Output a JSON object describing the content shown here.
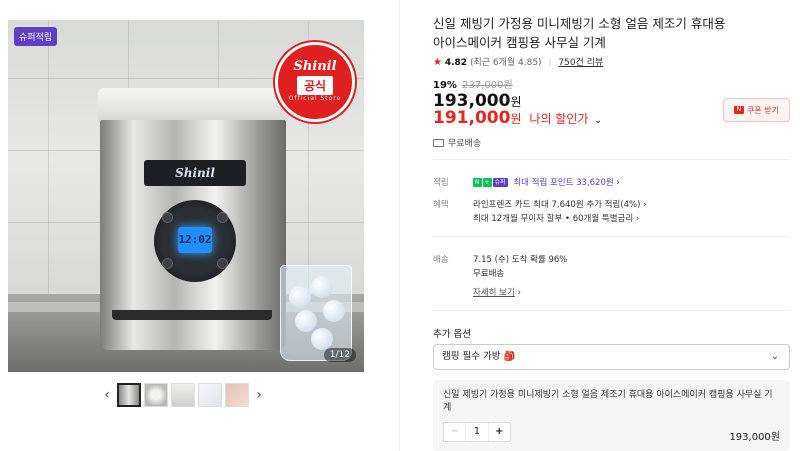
{
  "gallery": {
    "badge": "슈퍼적립",
    "seal": {
      "brand": "Shinil",
      "subtitle": "Official Store",
      "tag": "공식"
    },
    "machine_window_text": "Shinil",
    "lcd_text": "12:02",
    "image_counter": "1/12",
    "prev_icon": "chevron-left-icon",
    "next_icon": "chevron-right-icon"
  },
  "product": {
    "title": "신일 제빙기 가정용 미니제빙기 소형 얼음 제조기 휴대용 아이스메이커 캠핑용 사무실 기계",
    "rating": {
      "score": "4.82",
      "detail": "(최근 6개월 4.85)",
      "reviews": "750건 리뷰"
    },
    "discount_pct": "19%",
    "original_price": "237,000원",
    "price": "193,000",
    "price_unit": "원",
    "my_price": "191,000",
    "my_price_unit": "원",
    "my_price_label": "나의 할인가",
    "coupon_label": "쿠폰 받기",
    "free_shipping": "무료배송"
  },
  "details": {
    "points_label": "적립",
    "points_badges": [
      "N",
      "+",
      "슈퍼"
    ],
    "points_text": "최대 적립 포인트 33,620원",
    "benefit_label": "혜택",
    "benefit_line1": "라인프렌즈 카드 최대 7,640원 추가 적립(4%)",
    "benefit_line2": "최대 12개월 무이자 할부 • 60개월 특별금리",
    "delivery_label": "배송",
    "delivery_line1": "7.15 (수) 도착 확률 96%",
    "delivery_line2": "무료배송",
    "delivery_more": "자세히 보기"
  },
  "options": {
    "title": "추가 옵션",
    "select_value": "캠핑 필수 가방 🎒",
    "selected_item_name": "신일 제빙기 가정용 미니제빙기 소형 얼음 제조기 휴대용 아이스메이커 캠핑용 사무실 기계",
    "quantity": "1",
    "item_price": "193,000원"
  },
  "colors": {
    "accent_red": "#e9251c",
    "super_purple": "#5f3dc4",
    "naver_green": "#03c75a"
  }
}
